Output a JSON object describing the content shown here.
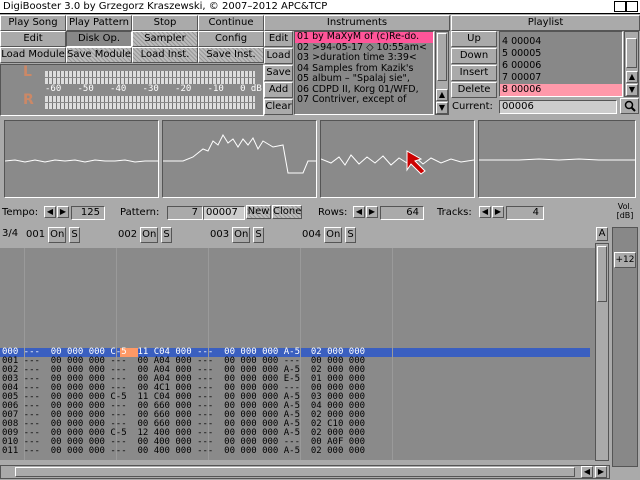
{
  "title": "DigiBooster 3.0 by Grzegorz Kraszewski, © 2007–2012 APC&TCP",
  "main_buttons": {
    "play_song": "Play Song",
    "play_pattern": "Play Pattern",
    "stop": "Stop",
    "continue": "Continue",
    "edit": "Edit",
    "disk_op": "Disk Op.",
    "sampler": "Sampler",
    "config": "Config",
    "load_module": "Load Module",
    "save_module": "Save Module",
    "load_inst": "Load Inst.",
    "save_inst": "Save Inst."
  },
  "vu": {
    "scale": "-60   -50   -40   -30   -20   -10   0 dB",
    "left": "L",
    "right": "R"
  },
  "instruments": {
    "header": "Instruments",
    "buttons": {
      "edit": "Edit",
      "load": "Load",
      "save": "Save",
      "add": "Add",
      "clear": "Clear"
    },
    "items": [
      "01  by MaXyM of (c)Re-do.",
      "02  >94-05-17 ◇ 10:55am<",
      "03  >duration time  3:39<",
      "04  Samples  from Kazik's",
      "05  album – \"Spalaj sie\",",
      "06  CDPD II, Korg 01/WFD,",
      "07  Contriver,  except  of"
    ]
  },
  "playlist": {
    "header": "Playlist",
    "buttons": {
      "up": "Up",
      "down": "Down",
      "insert": "Insert",
      "delete": "Delete"
    },
    "items": [
      "4  00004",
      "5  00005",
      "6  00006",
      "7  00007",
      "8  00006"
    ],
    "current_label": "Current:",
    "current_value": "00006"
  },
  "transport": {
    "tempo_label": "Tempo:",
    "tempo_value": "125",
    "pattern_label": "Pattern:",
    "pattern_num": "7",
    "pattern_name": "00007",
    "new_label": "New",
    "clone_label": "Clone",
    "rows_label": "Rows:",
    "rows_value": "64",
    "tracks_label": "Tracks:",
    "tracks_value": "4",
    "vol_label": "Vol.\n[dB]",
    "vol_value": "+12"
  },
  "tracks": {
    "position": "3/4",
    "list": [
      {
        "num": "001",
        "on": "On",
        "s": "S"
      },
      {
        "num": "002",
        "on": "On",
        "s": "S"
      },
      {
        "num": "003",
        "on": "On",
        "s": "S"
      },
      {
        "num": "004",
        "on": "On",
        "s": "S"
      }
    ],
    "scroll_a": "A"
  },
  "pattern_rows": [
    "000 ---  00 000 000 C-5  11 C04 000 ---  00 000 000 A-5  02 000 000",
    "001 ---  00 000 000 ---  00 A04 000 ---  00 000 000 ---  00 000 000",
    "002 ---  00 000 000 ---  00 A04 000 ---  00 000 000 A-5  02 000 000",
    "003 ---  00 000 000 ---  00 A04 000 ---  00 000 000 E-5  01 000 000",
    "004 ---  00 000 000 ---  00 4C1 000 ---  00 000 000 ---  00 000 000",
    "005 ---  00 000 000 C-5  11 C04 000 ---  00 000 000 A-5  03 000 000",
    "006 ---  00 000 000 ---  00 660 000 ---  00 000 000 A-5  04 000 000",
    "007 ---  00 000 000 ---  00 660 000 ---  00 000 000 A-5  02 000 000",
    "008 ---  00 000 000 ---  00 660 000 ---  00 000 000 A-5  02 C10 000",
    "009 ---  00 000 000 C-5  12 400 000 ---  00 000 000 A-5  02 000 000",
    "010 ---  00 000 000 ---  00 400 000 ---  00 000 000 ---  00 A0F 000",
    "011 ---  00 000 000 ---  00 400 000 ---  00 000 000 A-5  02 000 000"
  ],
  "colors": {
    "highlight_row": "#3a5fc0",
    "selected_item": "#ff5599",
    "background": "#aaaaaa"
  }
}
